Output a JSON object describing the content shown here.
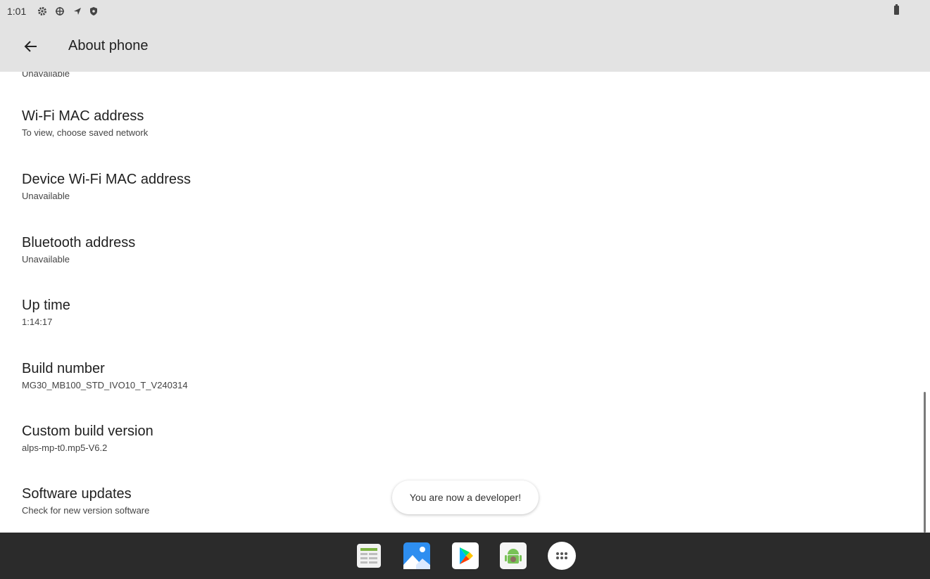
{
  "status_bar": {
    "time": "1:01",
    "icons": [
      "settings-gear-icon",
      "target-icon",
      "navigation-icon",
      "shield-icon"
    ],
    "battery_icon": "battery-icon"
  },
  "header": {
    "title": "About phone",
    "back_icon": "arrow-back-icon"
  },
  "list": {
    "cut_off_subtitle": "Unavailable",
    "items": [
      {
        "title": "Wi-Fi MAC address",
        "subtitle": "To view, choose saved network"
      },
      {
        "title": "Device Wi-Fi MAC address",
        "subtitle": "Unavailable"
      },
      {
        "title": "Bluetooth address",
        "subtitle": "Unavailable"
      },
      {
        "title": "Up time",
        "subtitle": "1:14:17"
      },
      {
        "title": "Build number",
        "subtitle": "MG30_MB100_STD_IVO10_T_V240314"
      },
      {
        "title": "Custom build version",
        "subtitle": "alps-mp-t0.mp5-V6.2"
      },
      {
        "title": "Software updates",
        "subtitle": "Check for new version software"
      }
    ]
  },
  "toast": {
    "message": "You are now a developer!"
  },
  "taskbar": {
    "apps": [
      "spreadsheet-app-icon",
      "gallery-app-icon",
      "play-store-icon",
      "android-app-icon",
      "app-drawer-icon"
    ]
  },
  "colors": {
    "appbar_bg": "#e3e3e3",
    "taskbar_bg": "#2b2b2b",
    "content_bg": "#ffffff"
  }
}
